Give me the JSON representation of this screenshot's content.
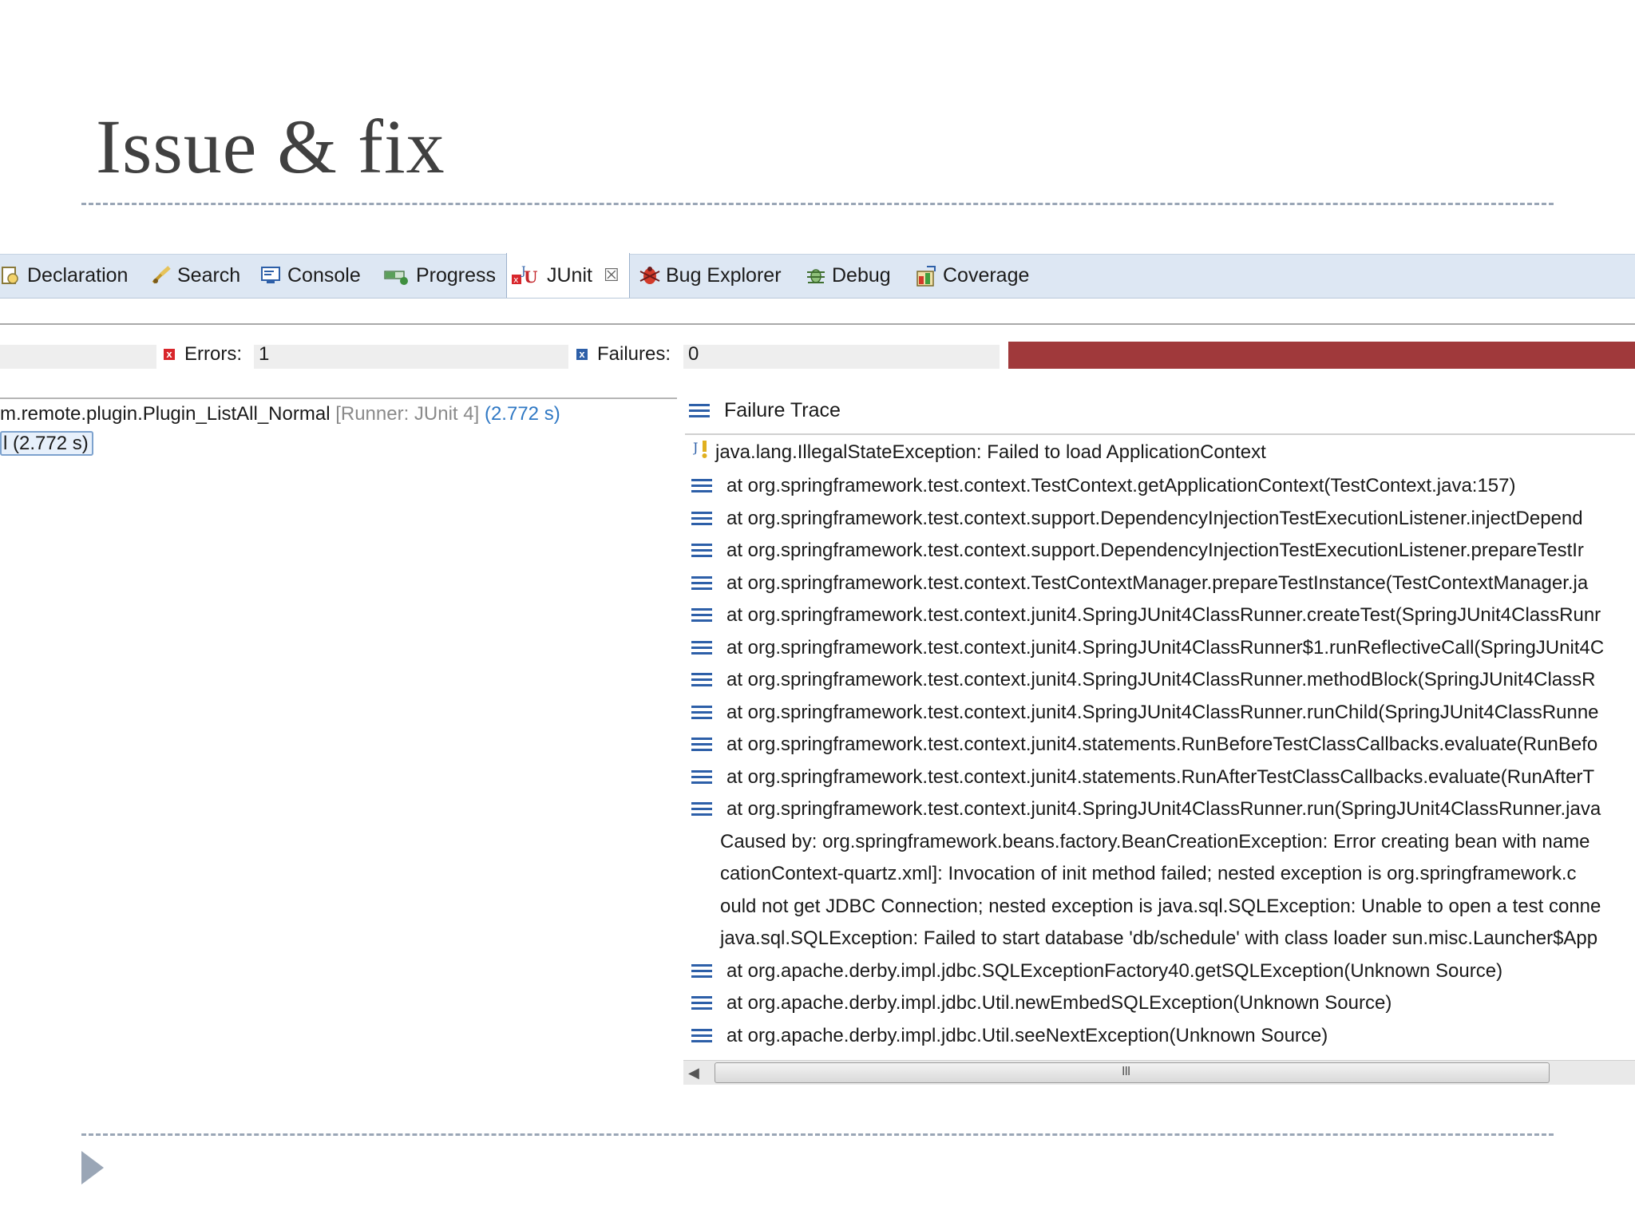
{
  "slide": {
    "title": "Issue & fix"
  },
  "tabs": [
    {
      "label": "Declaration",
      "icon": "declaration-icon"
    },
    {
      "label": "Search",
      "icon": "search-icon"
    },
    {
      "label": "Console",
      "icon": "console-icon"
    },
    {
      "label": "Progress",
      "icon": "progress-icon"
    },
    {
      "label": "JUnit",
      "icon": "junit-icon",
      "active": true
    },
    {
      "label": "Bug Explorer",
      "icon": "bug-icon"
    },
    {
      "label": "Debug",
      "icon": "debug-icon"
    },
    {
      "label": "Coverage",
      "icon": "coverage-icon"
    }
  ],
  "counters": {
    "errors_label": "Errors:",
    "errors_value": "1",
    "failures_label": "Failures:",
    "failures_value": "0",
    "bar_color": "#a0393b"
  },
  "tree": {
    "row1_name": "m.remote.plugin.Plugin_ListAll_Normal",
    "row1_runner": "[Runner: JUnit 4]",
    "row1_time": "(2.772 s)",
    "row2_text": "l (2.772 s)"
  },
  "trace": {
    "header": "Failure Trace",
    "exception": "java.lang.IllegalStateException: Failed to load ApplicationContext",
    "frames_top": [
      "at org.springframework.test.context.TestContext.getApplicationContext(TestContext.java:157)",
      "at org.springframework.test.context.support.DependencyInjectionTestExecutionListener.injectDepend",
      "at org.springframework.test.context.support.DependencyInjectionTestExecutionListener.prepareTestIr",
      "at org.springframework.test.context.TestContextManager.prepareTestInstance(TestContextManager.ja",
      "at org.springframework.test.context.junit4.SpringJUnit4ClassRunner.createTest(SpringJUnit4ClassRunr",
      "at org.springframework.test.context.junit4.SpringJUnit4ClassRunner$1.runReflectiveCall(SpringJUnit4C",
      "at org.springframework.test.context.junit4.SpringJUnit4ClassRunner.methodBlock(SpringJUnit4ClassR",
      "at org.springframework.test.context.junit4.SpringJUnit4ClassRunner.runChild(SpringJUnit4ClassRunne",
      "at org.springframework.test.context.junit4.statements.RunBeforeTestClassCallbacks.evaluate(RunBefo",
      "at org.springframework.test.context.junit4.statements.RunAfterTestClassCallbacks.evaluate(RunAfterT",
      "at org.springframework.test.context.junit4.SpringJUnit4ClassRunner.run(SpringJUnit4ClassRunner.java"
    ],
    "caused_by": [
      "Caused by: org.springframework.beans.factory.BeanCreationException: Error creating bean with name",
      "cationContext-quartz.xml]: Invocation of init method failed; nested exception is org.springframework.c",
      "ould not get JDBC Connection; nested exception is java.sql.SQLException: Unable to open a test conne",
      "java.sql.SQLException: Failed to start database 'db/schedule' with class loader sun.misc.Launcher$App"
    ],
    "frames_bottom": [
      "at org.apache.derby.impl.jdbc.SQLExceptionFactory40.getSQLException(Unknown Source)",
      "at org.apache.derby.impl.jdbc.Util.newEmbedSQLException(Unknown Source)",
      "at org.apache.derby.impl.jdbc.Util.seeNextException(Unknown Source)"
    ]
  },
  "scrollbar": {
    "grip": "III"
  }
}
